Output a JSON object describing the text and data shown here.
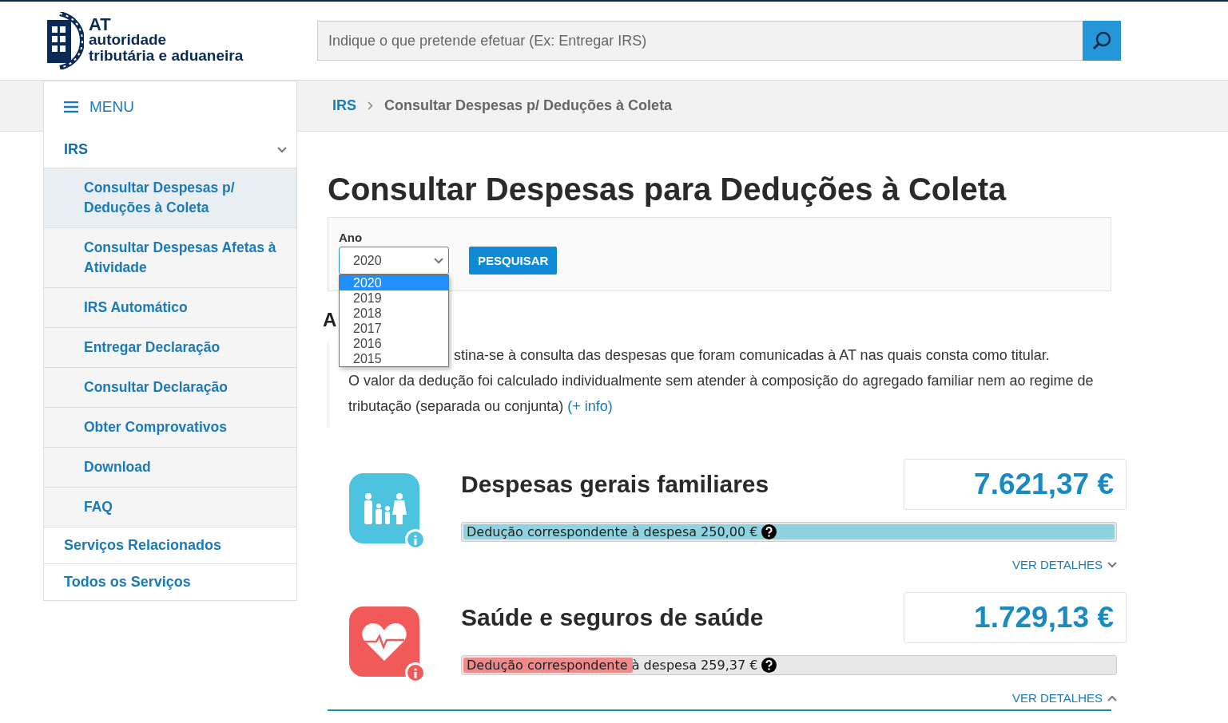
{
  "header": {
    "logo": {
      "short": "AT",
      "line1": "autoridade",
      "line2": "tributária e aduaneira"
    },
    "search": {
      "placeholder": "Indique o que pretende efetuar (Ex: Entregar IRS)"
    }
  },
  "menu": {
    "label": "MENU",
    "section": {
      "label": "IRS",
      "expanded": true,
      "items": [
        {
          "label": "Consultar Despesas p/ Deduções à Coleta",
          "selected": true
        },
        {
          "label": "Consultar Despesas Afetas à Atividade",
          "selected": false
        },
        {
          "label": "IRS Automático",
          "selected": false
        },
        {
          "label": "Entregar Declaração",
          "selected": false
        },
        {
          "label": "Consultar Declaração",
          "selected": false
        },
        {
          "label": "Obter Comprovativos",
          "selected": false
        },
        {
          "label": "Download",
          "selected": false
        },
        {
          "label": "FAQ",
          "selected": false
        }
      ]
    },
    "links": [
      "Serviços Relacionados",
      "Todos os Serviços"
    ]
  },
  "breadcrumb": [
    "IRS",
    "Consultar Despesas p/ Deduções à Coleta"
  ],
  "page_title": "Consultar Despesas para Deduções à Coleta",
  "filter": {
    "label": "Ano",
    "value": "2020",
    "open": true,
    "options": [
      {
        "label": "2020",
        "selected": true
      },
      {
        "label": "2019",
        "selected": false
      },
      {
        "label": "2018",
        "selected": false
      },
      {
        "label": "2017",
        "selected": false
      },
      {
        "label": "2016",
        "selected": false
      },
      {
        "label": "2015",
        "selected": false
      }
    ],
    "button": "PESQUISAR"
  },
  "section_heading": "A",
  "intro": {
    "line1": "stina-se à consulta das despesas que foram comunicadas à AT nas quais consta como titular.",
    "line2": "O valor da dedução foi calculado individualmente sem atender à composição do agregado familiar nem ao regime de tributação (separada ou conjunta)",
    "link": "(+ info)"
  },
  "categories": [
    {
      "kind": "family",
      "title": "Despesas gerais familiares",
      "amount": "7.621,37 €",
      "color": "#4ec3df",
      "deduction": "Dedução correspondente à despesa 250,00 €",
      "level": 1,
      "details": "VER DETALHES",
      "expanded": false
    },
    {
      "kind": "health",
      "title": "Saúde e seguros de saúde",
      "amount": "1.729,13 €",
      "color": "#f25a5a",
      "deduction": "Dedução correspondente à despesa 259,37 €",
      "level": 0.26,
      "details": "VER DETALHES",
      "expanded": true
    }
  ]
}
